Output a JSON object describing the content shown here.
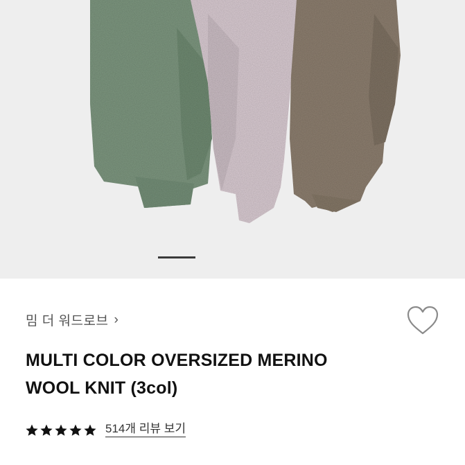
{
  "product": {
    "brand_name": "밈 더 워드로브",
    "title_line1": "MULTI COLOR OVERSIZED MERINO",
    "title_line2": "WOOL KNIT (3col)",
    "rating_stars": 5,
    "review_link": "514개 리뷰 보기"
  },
  "gallery": {
    "colors": {
      "background": "#eeeeee",
      "green": "#7e9780",
      "pink": "#d9cbd2",
      "brown": "#8d7f70"
    },
    "active_indicator": 1
  },
  "icons": {
    "brand_chevron": "chevron-right-icon",
    "wishlist": "heart-outline-icon",
    "star": "star-filled-icon"
  }
}
